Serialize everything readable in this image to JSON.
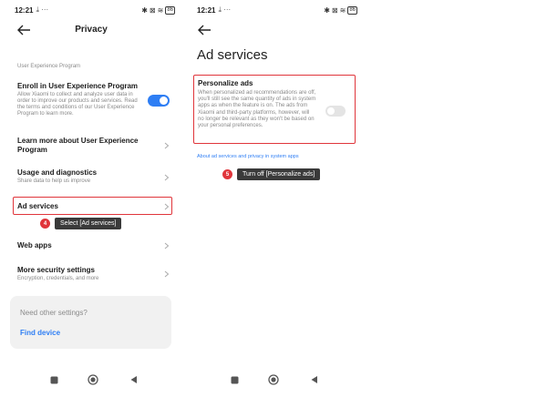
{
  "left_screen": {
    "status": {
      "time": "12:21",
      "extra": "⤓ ···",
      "battery": "86"
    },
    "title": "Privacy",
    "section_label": "User Experience Program",
    "rows": [
      {
        "title": "Enroll in User Experience Program",
        "subtitle": "Allow Xiaomi to collect and analyze user data in order to improve our products and services. Read the terms and conditions of our User Experience Program to learn more."
      },
      {
        "title": "Learn more about User Experience Program",
        "subtitle": ""
      },
      {
        "title": "Usage and diagnostics",
        "subtitle": "Share data to help us improve"
      },
      {
        "title": "Ad services",
        "subtitle": ""
      },
      {
        "title": "Web apps",
        "subtitle": ""
      },
      {
        "title": "More security settings",
        "subtitle": "Encryption, credentials, and more"
      }
    ],
    "callout": {
      "step": "4",
      "text": "Select [Ad services]"
    },
    "card": {
      "question": "Need other settings?",
      "link": "Find device"
    }
  },
  "right_screen": {
    "status": {
      "time": "12:21",
      "extra": "⤓ ···",
      "battery": "86"
    },
    "title": "Ad services",
    "personalize": {
      "title": "Personalize ads",
      "description": "When personalized ad recommendations are off, you'll still see the same quantity of ads in system apps as when the feature is on. The ads from Xiaomi and third-party platforms, however, will no longer be relevant as they won't be based on your personal preferences."
    },
    "privacy_link": "About ad services and privacy in system apps",
    "callout": {
      "step": "5",
      "text": "Turn off [Personalize ads]"
    }
  },
  "status_icons": [
    "bluetooth-icon",
    "mute-icon",
    "wifi-icon",
    "battery-icon"
  ],
  "colors": {
    "accent": "#2e7ef4",
    "highlight": "#e0353b",
    "tooltip": "#3a3a3a"
  }
}
